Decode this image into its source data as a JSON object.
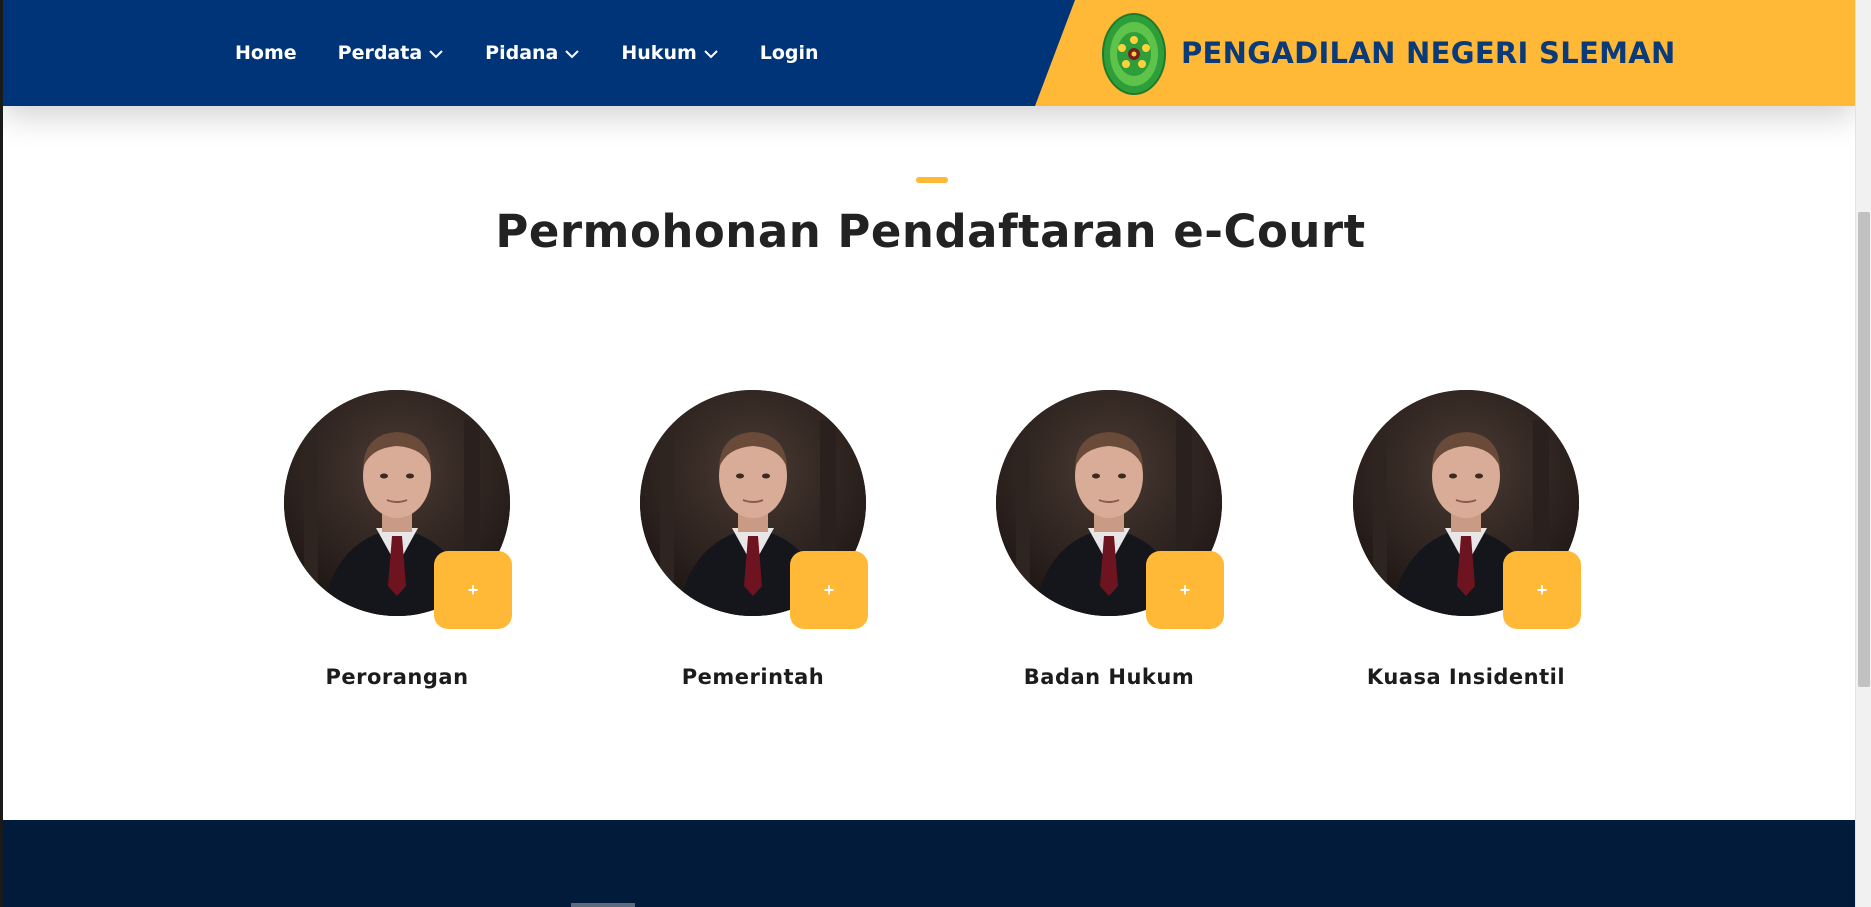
{
  "header": {
    "nav": [
      {
        "label": "Home",
        "has_dropdown": false
      },
      {
        "label": "Perdata",
        "has_dropdown": true
      },
      {
        "label": "Pidana",
        "has_dropdown": true
      },
      {
        "label": "Hukum",
        "has_dropdown": true
      },
      {
        "label": "Login",
        "has_dropdown": false
      }
    ],
    "brand_title": "PENGADILAN NEGERI SLEMAN",
    "logo_icon": "court-seal-logo",
    "logo_text": "PENGADILAN NEGERI SLEMAN"
  },
  "section": {
    "title": "Permohonan Pendaftaran e-Court",
    "cards": [
      {
        "label": "Perorangan",
        "button": "+"
      },
      {
        "label": "Pemerintah",
        "button": "+"
      },
      {
        "label": "Badan Hukum",
        "button": "+"
      },
      {
        "label": "Kuasa Insidentil",
        "button": "+"
      }
    ]
  },
  "colors": {
    "header_bg": "#003479",
    "accent": "#ffb936",
    "brand_text": "#0b3a78",
    "footer_bg": "#031b3a"
  }
}
